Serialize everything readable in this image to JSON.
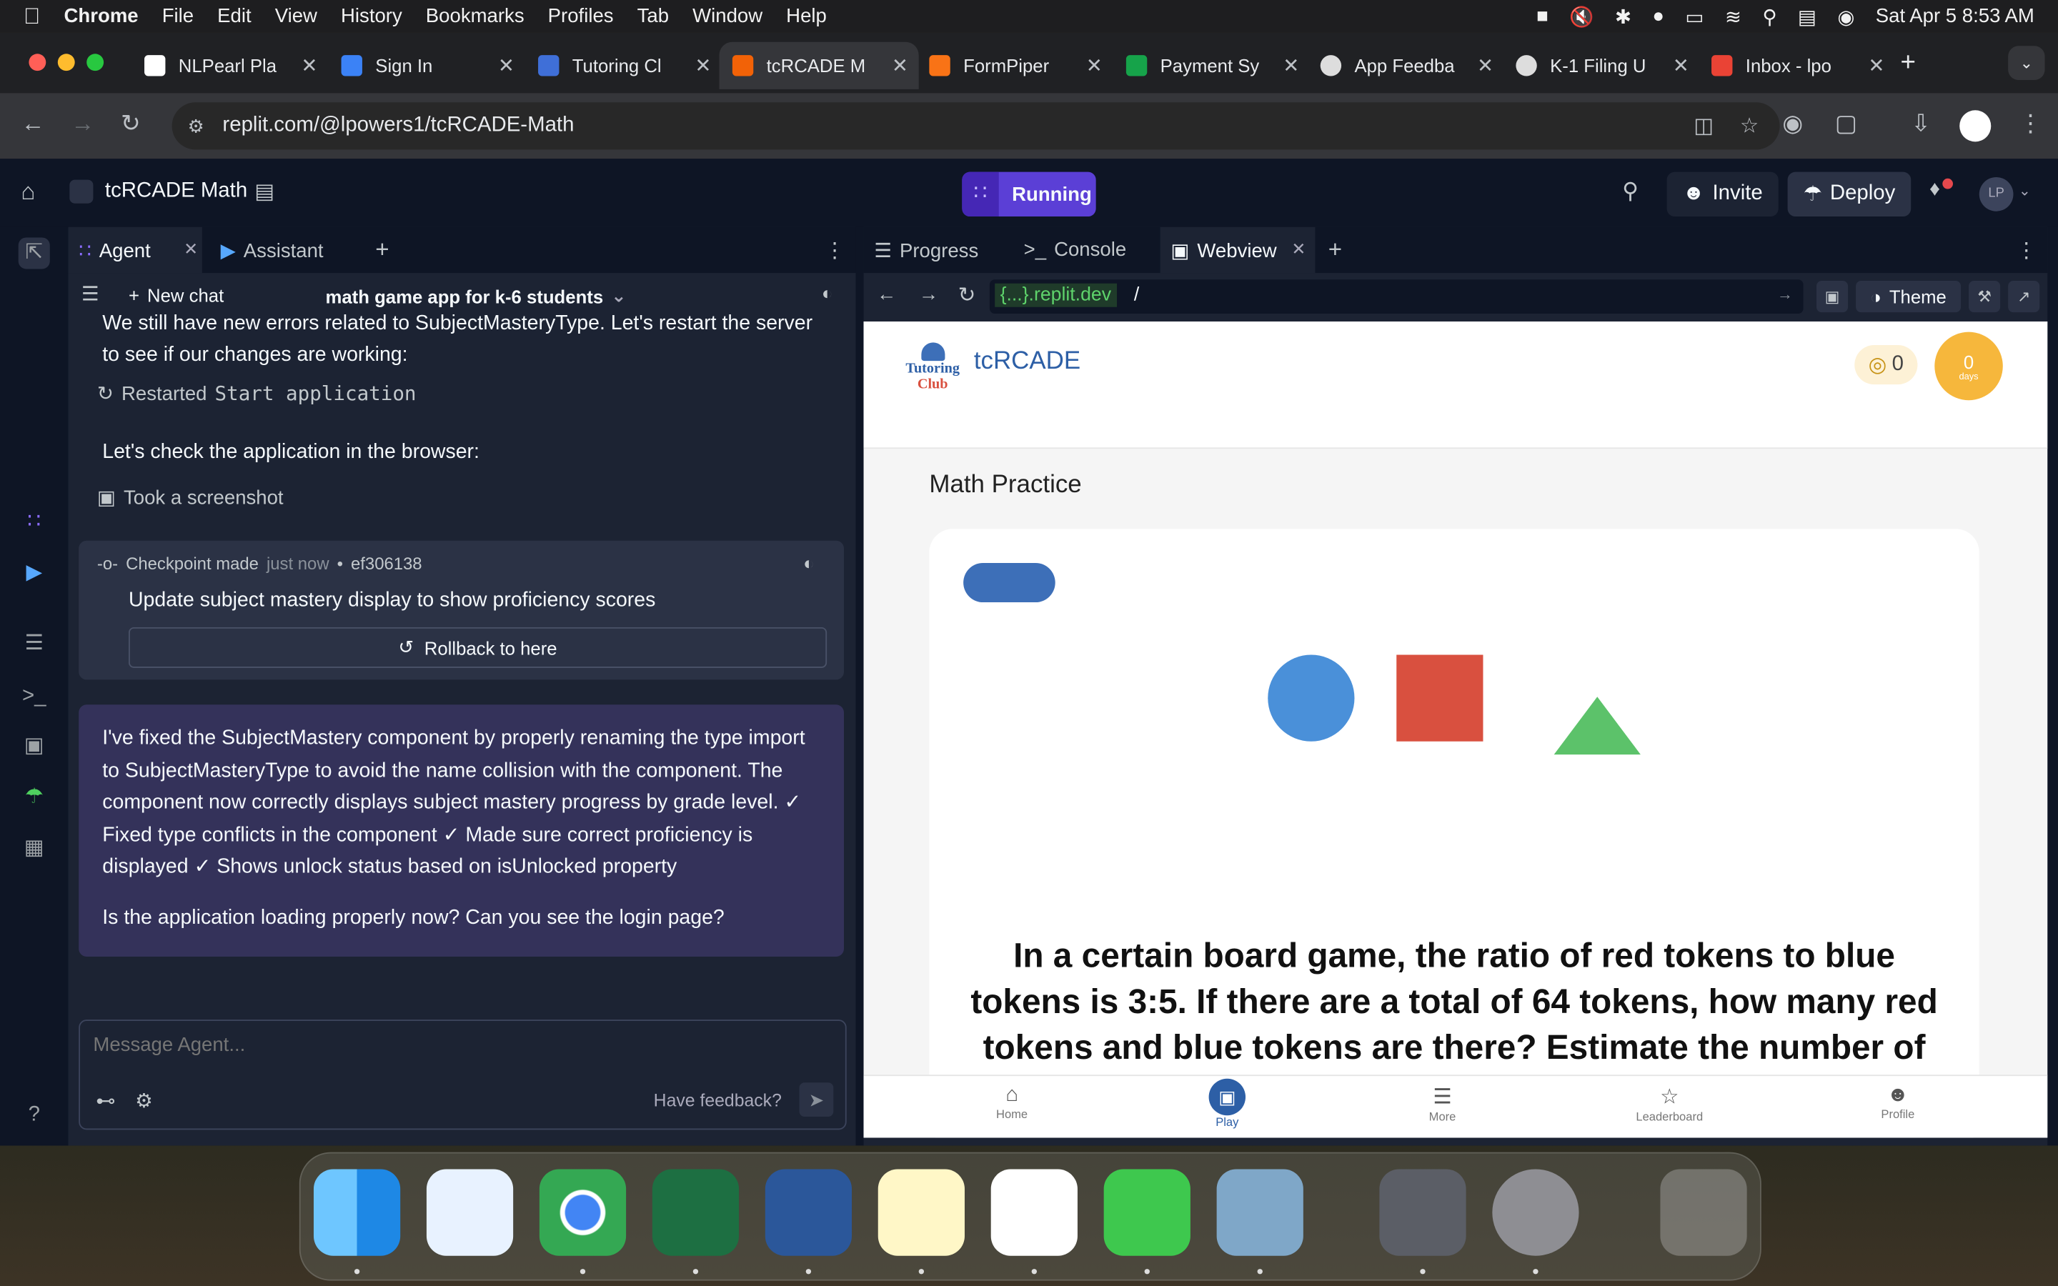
{
  "menubar": {
    "app": "Chrome",
    "items": [
      "File",
      "Edit",
      "View",
      "History",
      "Bookmarks",
      "Profiles",
      "Tab",
      "Window",
      "Help"
    ],
    "datetime": "Sat Apr 5  8:53 AM"
  },
  "tabs": [
    {
      "label": "NLPearl Pla",
      "color": "#ffffff"
    },
    {
      "label": "Sign In",
      "color": "#3b82f6"
    },
    {
      "label": "Tutoring Cl",
      "color": "#3f6fd8"
    },
    {
      "label": "tcRCADE M",
      "color": "#f26207"
    },
    {
      "label": "FormPiper",
      "color": "#f97316"
    },
    {
      "label": "Payment Sy",
      "color": "#16a34a"
    },
    {
      "label": "App Feedba",
      "color": "#dddddd"
    },
    {
      "label": "K-1 Filing U",
      "color": "#dddddd"
    },
    {
      "label": "Inbox - lpo",
      "color": "#ea4335"
    }
  ],
  "address": {
    "url": "replit.com/@lpowers1/tcRCADE-Math"
  },
  "replit": {
    "project": "tcRCADE Math",
    "run_status": "Running",
    "invite": "Invite",
    "deploy": "Deploy",
    "avatar": "LP",
    "left_tabs": {
      "agent": "Agent",
      "assistant": "Assistant"
    },
    "new_chat": "New chat",
    "chat_title": "math game app for k-6 students",
    "right_tabs": {
      "progress": "Progress",
      "console": "Console",
      "webview": "Webview"
    },
    "webview_url_host": "{...}.replit.dev",
    "webview_url_path": "/",
    "theme": "Theme"
  },
  "chat": {
    "msg1": "We still have new errors related to SubjectMasteryType. Let's restart the server to see if our changes are working:",
    "action1_label": "Restarted",
    "action1_code": "Start application",
    "msg2": "Let's check the application in the browser:",
    "action2": "Took a screenshot",
    "checkpoint_label": "Checkpoint made",
    "checkpoint_time": "just now",
    "checkpoint_sep": "•",
    "checkpoint_hash": "ef306138",
    "checkpoint_desc": "Update subject mastery display to show proficiency scores",
    "rollback": "Rollback to here",
    "reply": "I've fixed the SubjectMastery component by properly renaming the type import to SubjectMasteryType to avoid the name collision with the component. The component now correctly displays subject mastery progress by grade level. ✓ Fixed type conflicts in the component ✓ Made sure correct proficiency is displayed ✓ Shows unlock status based on isUnlocked property",
    "reply_question": "Is the application loading properly now? Can you see the login page?",
    "input_placeholder": "Message Agent...",
    "feedback": "Have feedback?"
  },
  "webapp": {
    "brand": "tcRCADE",
    "logo_line1": "Tutoring",
    "logo_line2": "Club",
    "coins": "0",
    "streak_value": "0",
    "streak_unit": "days",
    "section_title": "Math Practice",
    "question": "In a certain board game, the ratio of red tokens to blue tokens is 3:5. If there are a total of 64 tokens, how many red tokens and blue tokens are there? Estimate the number of",
    "nav": [
      "Home",
      "Play",
      "More",
      "Leaderboard",
      "Profile"
    ],
    "colors": {
      "circle": "#4a90d9",
      "square": "#d9503f",
      "triangle": "#5cc26a",
      "pill": "#3d6fb8",
      "streak": "#f6b73c"
    }
  }
}
